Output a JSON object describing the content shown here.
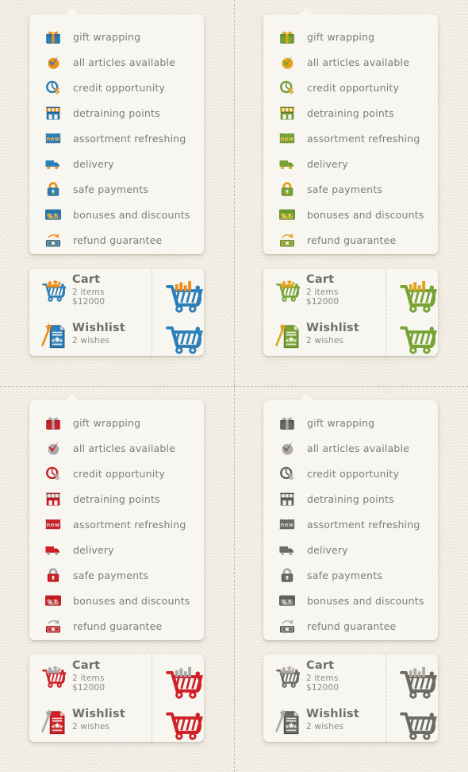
{
  "background": {
    "color": "#efebdf",
    "texture": "linen"
  },
  "layout": {
    "columns": 2,
    "rows": 2,
    "variants": [
      "blue",
      "green",
      "red",
      "gray"
    ]
  },
  "themes": {
    "blue": {
      "name": "blue",
      "primary": "#2c7fb8",
      "primary_dark": "#1f5f8f",
      "accent": "#f08c1b",
      "accent_light": "#f5b43c",
      "outline": "#1e5b85"
    },
    "green": {
      "name": "green",
      "primary": "#76a333",
      "primary_dark": "#5c7f22",
      "accent": "#e0a31e",
      "accent_light": "#f0c454",
      "outline": "#5a7d21"
    },
    "red": {
      "name": "red",
      "primary": "#cf2027",
      "primary_dark": "#a6161c",
      "accent": "#a8a8a8",
      "accent_light": "#cfcfcf",
      "outline": "#a0161b"
    },
    "gray": {
      "name": "gray",
      "primary": "#6b6b63",
      "primary_dark": "#4c4c46",
      "accent": "#b0aba0",
      "accent_light": "#d2cec4",
      "outline": "#4a4a44"
    }
  },
  "feature_panel": {
    "items": [
      {
        "icon": "gift-icon",
        "label": "gift wrapping"
      },
      {
        "icon": "checkmark-icon",
        "label": "all articles available"
      },
      {
        "icon": "clock-dollar-icon",
        "label": "credit opportunity"
      },
      {
        "icon": "shop-icon",
        "label": "detraining points"
      },
      {
        "icon": "new-badge-icon",
        "label": "assortment refreshing"
      },
      {
        "icon": "truck-icon",
        "label": "delivery"
      },
      {
        "icon": "lock-icon",
        "label": "safe payments"
      },
      {
        "icon": "discount-card-icon",
        "label": "bonuses and discounts"
      },
      {
        "icon": "refund-money-icon",
        "label": "refund guarantee"
      }
    ]
  },
  "cart_panel": {
    "rows": [
      {
        "icon": "cart-star-icon",
        "title": "Cart",
        "sub1": "2 items",
        "sub2": "$12000"
      },
      {
        "icon": "wishlist-wand-icon",
        "title": "Wishlist",
        "sub1": "2 wishes",
        "sub2": ""
      }
    ],
    "side_icons": [
      {
        "icon": "cart-full-icon"
      },
      {
        "icon": "cart-empty-icon"
      }
    ]
  }
}
